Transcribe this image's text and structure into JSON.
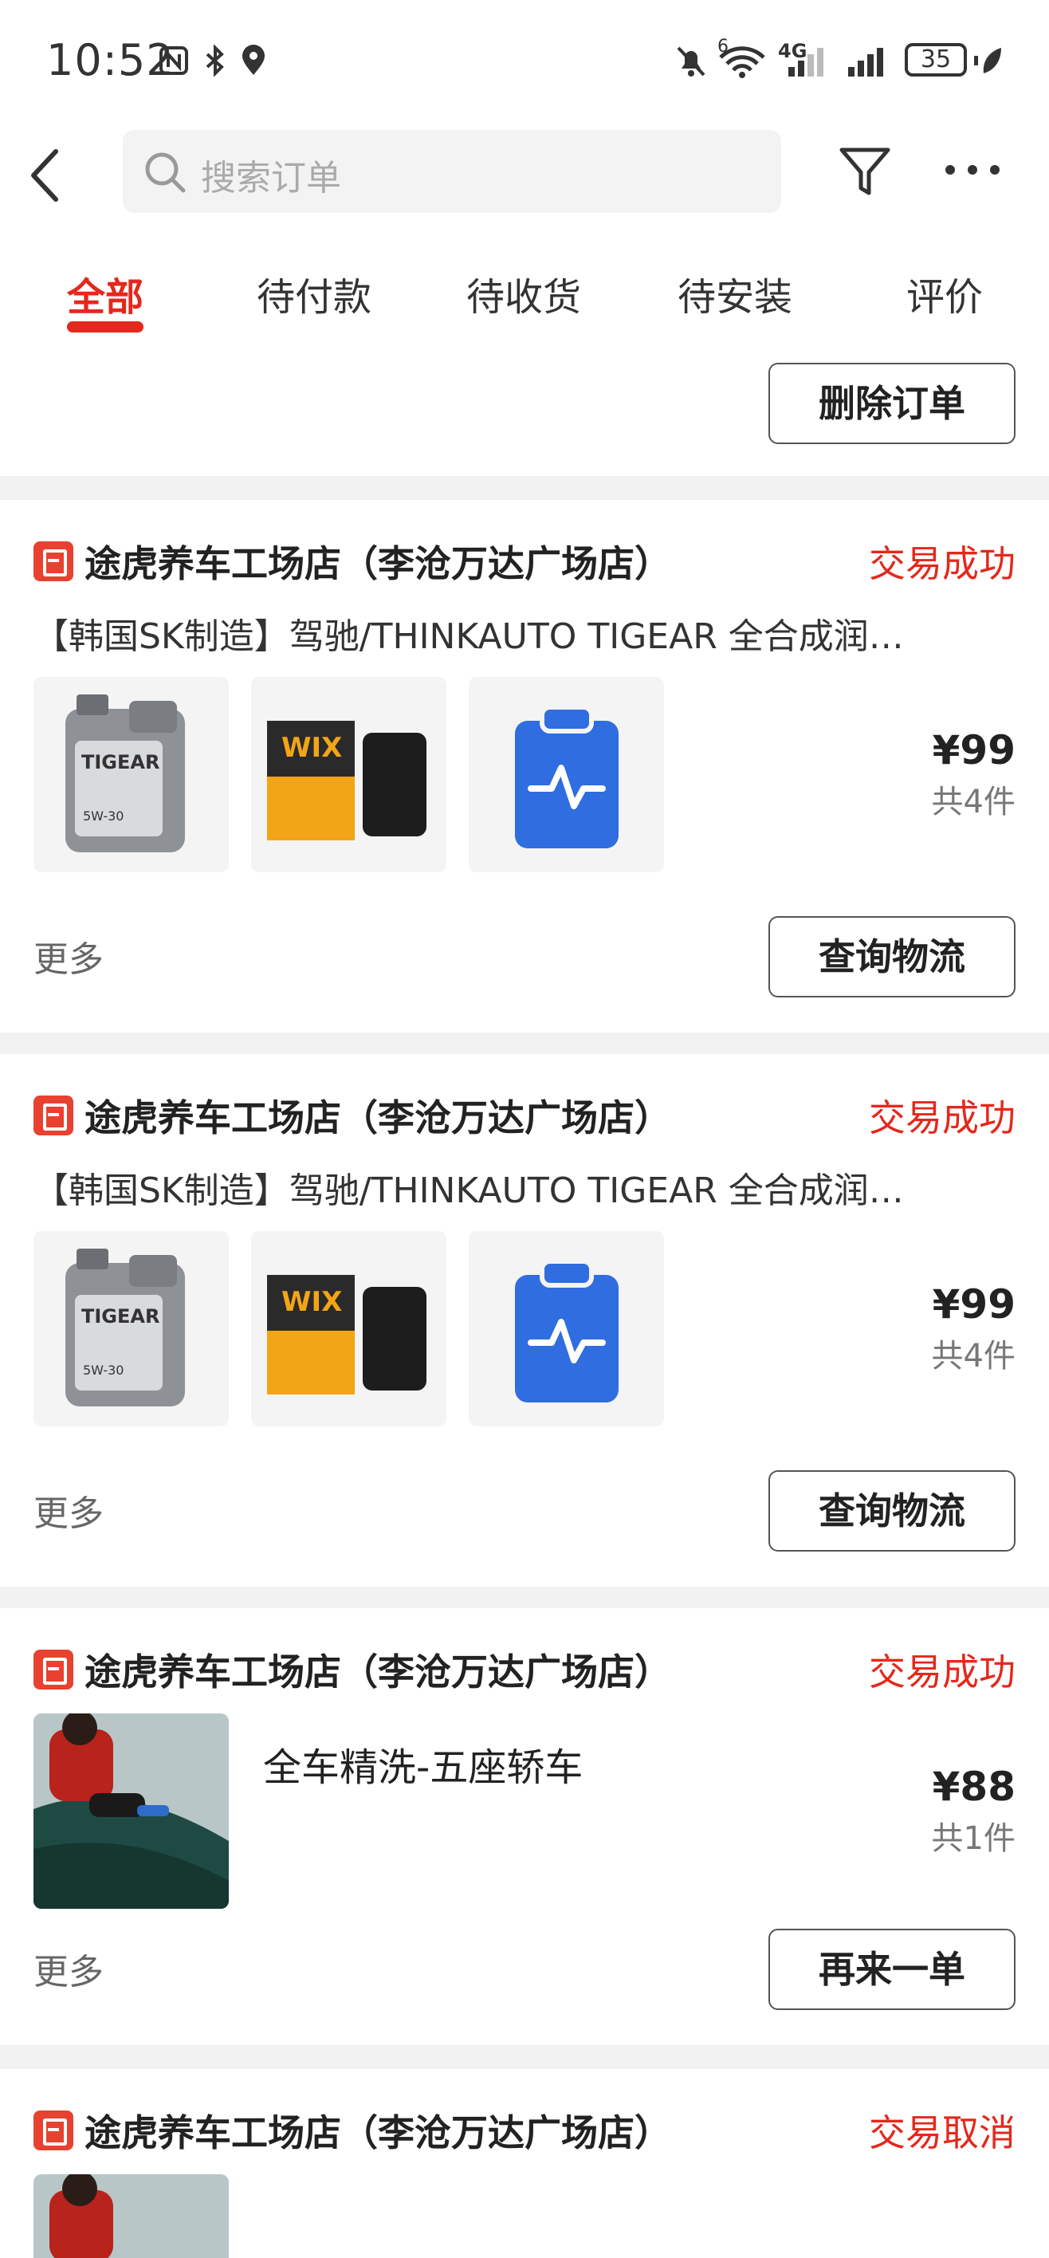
{
  "status_bar": {
    "time": "10:52",
    "network": "4G",
    "wifi_badge": "6",
    "battery": "35"
  },
  "header": {
    "search_placeholder": "搜索订单"
  },
  "tabs": [
    {
      "label": "全部",
      "active": true
    },
    {
      "label": "待付款",
      "active": false
    },
    {
      "label": "待收货",
      "active": false
    },
    {
      "label": "待安装",
      "active": false
    },
    {
      "label": "评价",
      "active": false
    }
  ],
  "top_card": {
    "button": "删除订单"
  },
  "orders": [
    {
      "store": "途虎养车工场店（李沧万达广场店）",
      "status": "交易成功",
      "title": "【韩国SK制造】驾驰/THINKAUTO TIGEAR 全合成润…",
      "price": "¥99",
      "count": "共4件",
      "more": "更多",
      "button": "查询物流"
    },
    {
      "store": "途虎养车工场店（李沧万达广场店）",
      "status": "交易成功",
      "title": "【韩国SK制造】驾驰/THINKAUTO TIGEAR 全合成润…",
      "price": "¥99",
      "count": "共4件",
      "more": "更多",
      "button": "查询物流"
    },
    {
      "store": "途虎养车工场店（李沧万达广场店）",
      "status": "交易成功",
      "service_name": "全车精洗-五座轿车",
      "price": "¥88",
      "count": "共1件",
      "more": "更多",
      "button": "再来一单"
    },
    {
      "store": "途虎养车工场店（李沧万达广场店）",
      "status": "交易取消"
    }
  ],
  "product_labels": {
    "oil_brand": "TIGEAR",
    "oil_grade": "5W-30",
    "filter_brand": "WIX"
  },
  "colors": {
    "accent": "#e4281c",
    "store_icon": "#e8412f",
    "report_icon": "#2f6de0"
  }
}
